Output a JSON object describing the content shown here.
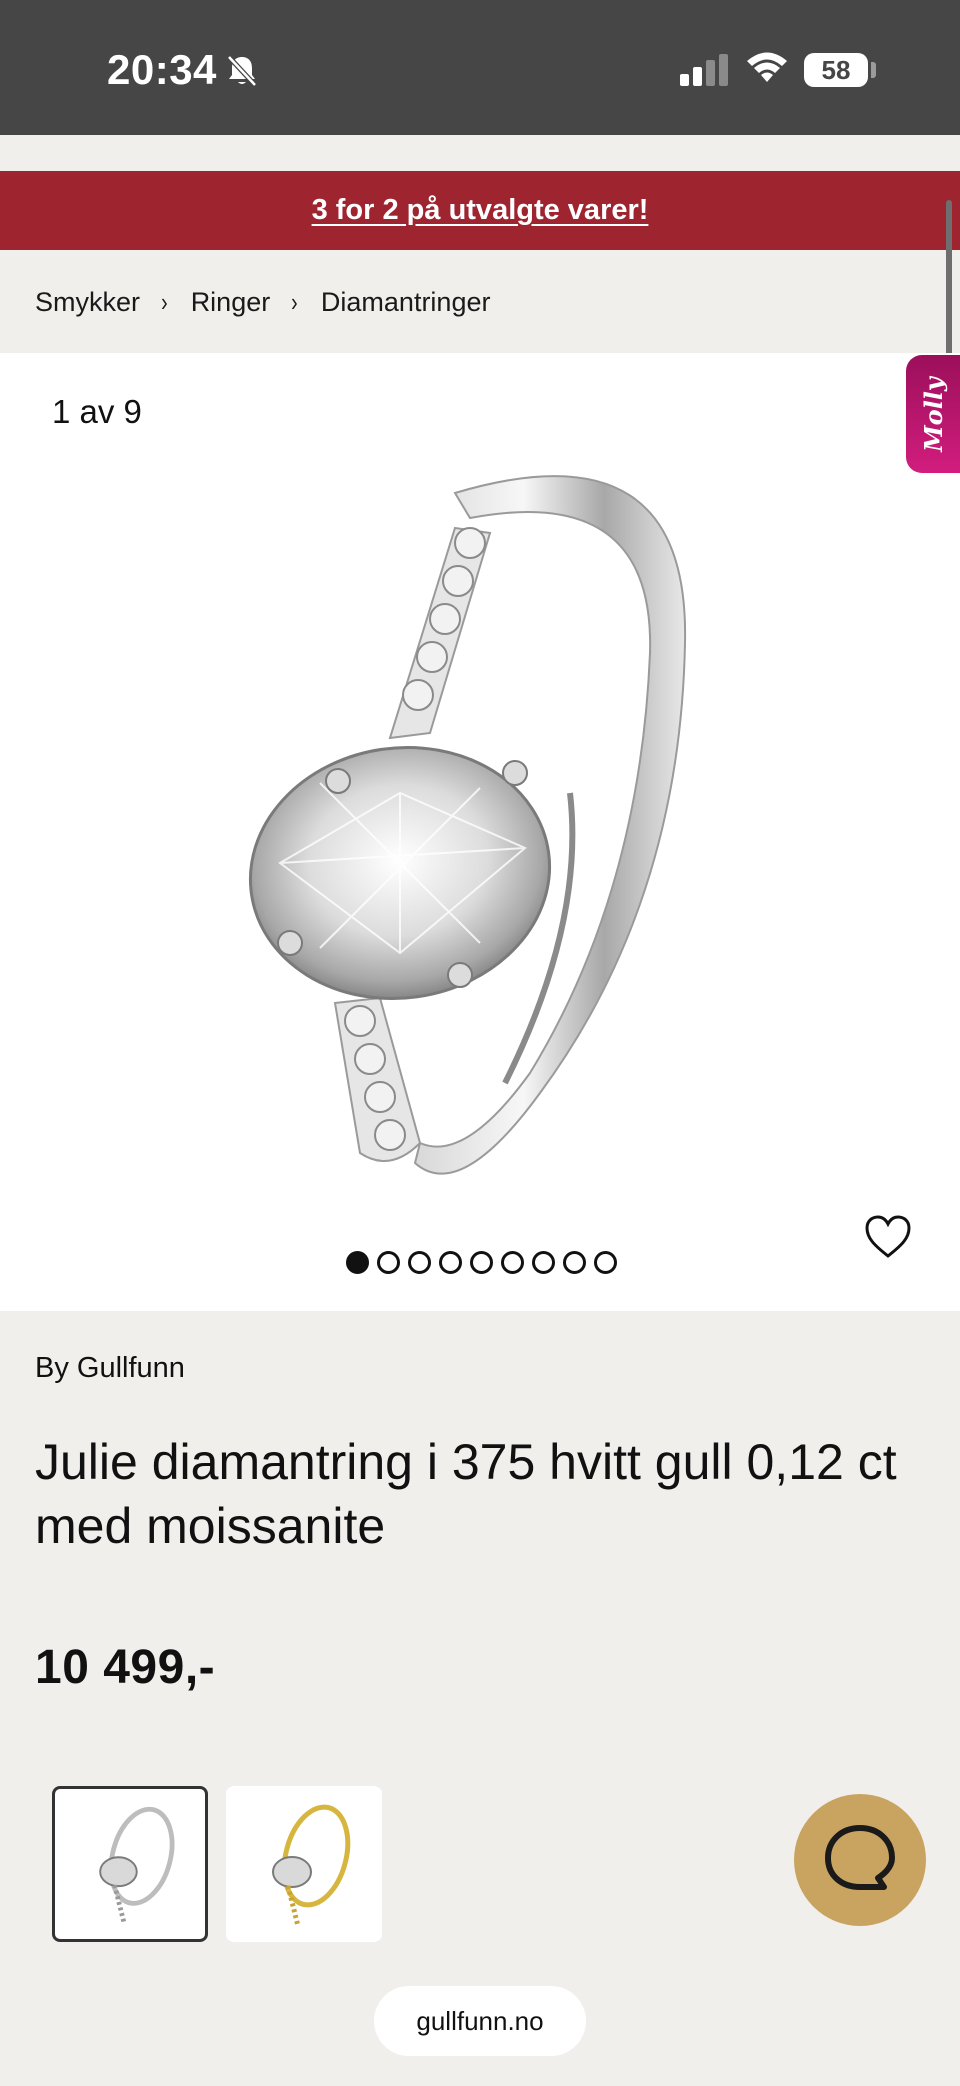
{
  "status_bar": {
    "time": "20:34",
    "battery": "58"
  },
  "promo": {
    "text": "3 for 2 på utvalgte varer!"
  },
  "breadcrumb": {
    "items": [
      "Smykker",
      "Ringer",
      "Diamantringer"
    ],
    "separator": "›"
  },
  "gallery": {
    "counter": "1 av 9",
    "total_images": 9,
    "active_index": 0
  },
  "side_tab": {
    "label": "Molly"
  },
  "product": {
    "brand": "By Gullfunn",
    "title": "Julie diamantring i 375 hvitt gull 0,12 ct med moissanite",
    "price": "10 499,-"
  },
  "variants": [
    {
      "name": "white-gold",
      "selected": true
    },
    {
      "name": "yellow-gold",
      "selected": false
    }
  ],
  "colors": {
    "banner": "#9e2430",
    "chat": "#c9a461",
    "side_tab": "#c21a74",
    "status_bar": "#464646",
    "page_bg": "#f1efec"
  },
  "icons": {
    "heart": "heart-icon",
    "chat": "chat-bubble-icon",
    "bell": "bell-slash-icon"
  },
  "browser": {
    "url": "gullfunn.no"
  }
}
